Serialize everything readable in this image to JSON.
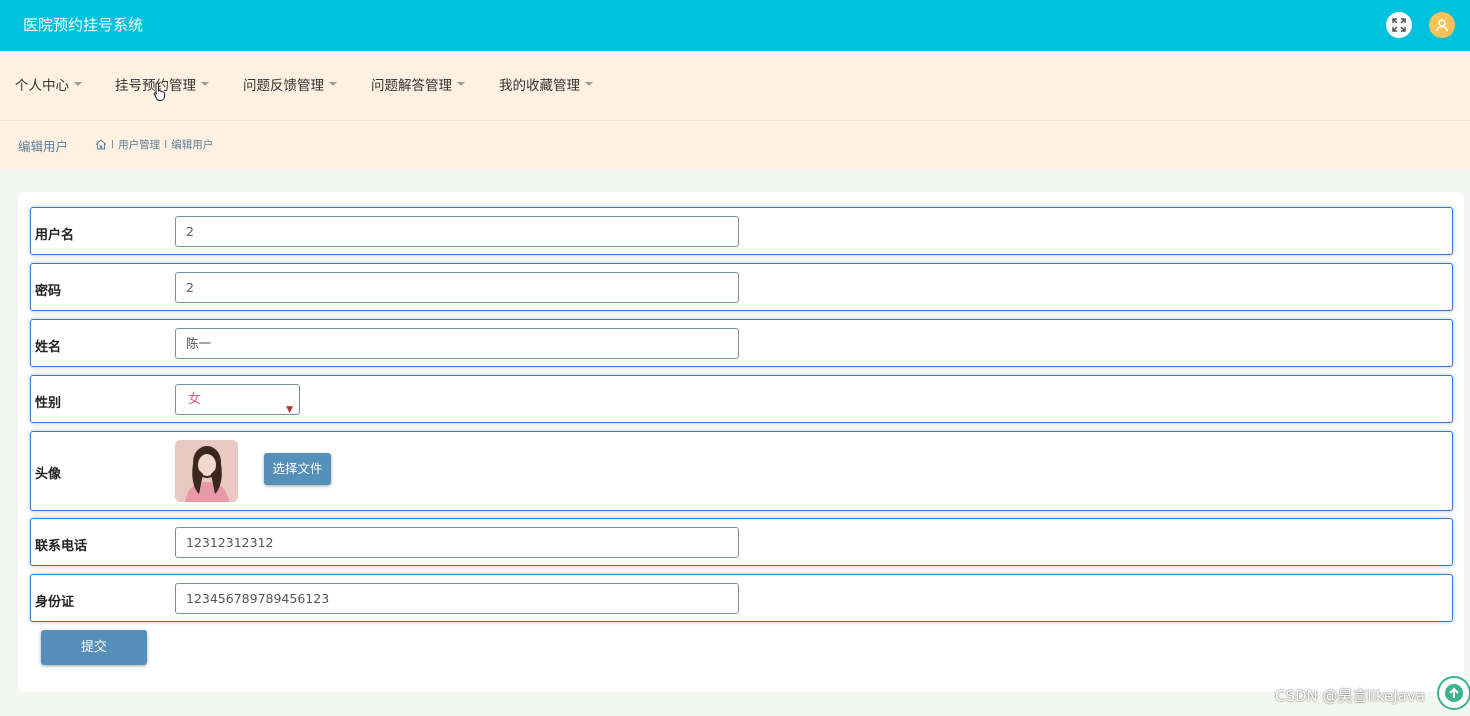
{
  "header": {
    "app_title": "医院预约挂号系统",
    "fullscreen_icon": "fullscreen-icon",
    "user_icon": "user-avatar-icon"
  },
  "menu": {
    "items": [
      {
        "label": "个人中心"
      },
      {
        "label": "挂号预约管理"
      },
      {
        "label": "问题反馈管理"
      },
      {
        "label": "问题解答管理"
      },
      {
        "label": "我的收藏管理"
      }
    ]
  },
  "breadcrumb": {
    "page_title": "编辑用户",
    "separator": "I",
    "path": [
      "用户管理",
      "编辑用户"
    ]
  },
  "form": {
    "username": {
      "label": "用户名",
      "value": "2"
    },
    "password": {
      "label": "密码",
      "value": "2"
    },
    "name": {
      "label": "姓名",
      "value": "陈一"
    },
    "gender": {
      "label": "性别",
      "value": "女"
    },
    "avatar": {
      "label": "头像",
      "button_label": "选择文件"
    },
    "phone": {
      "label": "联系电话",
      "value": "12312312312"
    },
    "id_card": {
      "label": "身份证",
      "value": "123456789789456123"
    },
    "submit_label": "提交"
  },
  "watermark": "CSDN @昊言likeJava",
  "colors": {
    "topbar": "#00c1de",
    "menubar": "#fff1e2",
    "primary_button": "#5590bb",
    "row_border": "#3c78c8"
  }
}
